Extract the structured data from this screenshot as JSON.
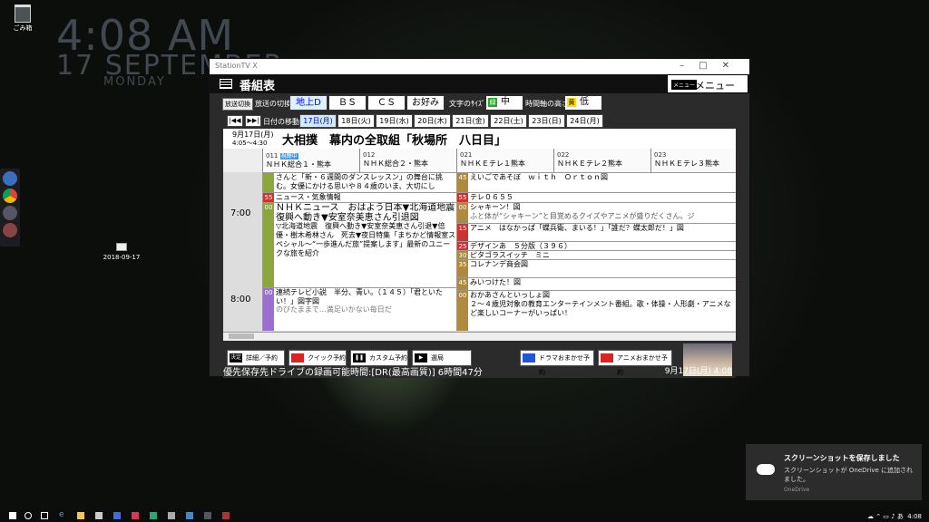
{
  "desktop": {
    "time": "4:08 AM",
    "date": "17 SEPTEMBER",
    "day": "MONDAY",
    "recycle_label": "ごみ箱",
    "shot_label": "2018-09-17"
  },
  "window": {
    "title": "StationTV X",
    "header": "番組表",
    "menu_key": "メニュー",
    "menu": "メニュー"
  },
  "toolbar": {
    "switch_key": "放送切換",
    "switch_label": "放送の切換",
    "tabs": [
      "地上D",
      "ＢＳ",
      "ＣＳ",
      "お好み"
    ],
    "text_size_label": "文字のｻｲｽﾞ",
    "text_size_key": "緑",
    "text_size": "中",
    "axis_label": "時間軸の高さ",
    "axis_key": "黄",
    "axis": "低"
  },
  "datebar": {
    "move_label": "日付の移動",
    "days": [
      "17日(月)",
      "18日(火)",
      "19日(水)",
      "20日(木)",
      "21日(金)",
      "22日(土)",
      "23日(日)",
      "24日(月)"
    ]
  },
  "program": {
    "date": "9月17日(月)",
    "time": "4:05～4:30",
    "title": "大相撲　幕内の全取組「秋場所　八日目」"
  },
  "channels": [
    {
      "num": "011",
      "live": "視聴中",
      "name": "ＮＨＫ総合１・熊本"
    },
    {
      "num": "012",
      "name": "ＮＨＫ総合２・熊本"
    },
    {
      "num": "021",
      "name": "ＮＨＫＥテレ１熊本"
    },
    {
      "num": "022",
      "name": "ＮＨＫＥテレ２熊本"
    },
    {
      "num": "023",
      "name": "ＮＨＫＥテレ３熊本"
    }
  ],
  "times": [
    "7:00",
    "8:00"
  ],
  "col1": [
    {
      "min": "",
      "text": "さんと「新・６週間のダンスレッスン」の舞台に挑む。女優にかける思いや８４歳のいま、大切にし"
    },
    {
      "min": "55",
      "text": "ニュース・気象情報"
    },
    {
      "min": "00",
      "text": "ＮＨＫニュース　おはよう日本▼北海道地震　復興へ動き▼安室奈美恵さん引退図"
    },
    {
      "min": "",
      "text": "▽北海道地震　復興へ動き▼安室奈美恵さん引退▼倍優・樹木希林さん　死去▼夜日特集「まちかど情報室スペシャル〜“一歩進んだ旅”提案します」最新のユニークな旅を紹介"
    },
    {
      "min": "00",
      "text": "連続テレビ小説　半分、青い。（１４５）「君といたい！」図字図"
    },
    {
      "min": "",
      "text": "のびたままで…満足いかない毎日だ"
    }
  ],
  "col3": [
    {
      "min": "45",
      "text": "えいごであそぼ　ｗｉｔｈ　Ｏｒｔｏｎ図"
    },
    {
      "min": "55",
      "text": "テレ０６５５"
    },
    {
      "min": "00",
      "text": "シャキーン！図"
    },
    {
      "min": "",
      "text": "ふと体が“シャキーン”と目覚めるクイズやアニメが盛りだくさん。ジ"
    },
    {
      "min": "15",
      "text": "アニメ　はなかっぱ「蝶兵衛、まいる！」「誰だ？蝶太郎だ！」図"
    },
    {
      "min": "25",
      "text": "デザインあ　５分版（３９６）"
    },
    {
      "min": "30",
      "text": "ピタゴラスイッチ　ミニ"
    },
    {
      "min": "35",
      "text": "コレナンデ商会図"
    },
    {
      "min": "45",
      "text": "みいつけた！図"
    },
    {
      "min": "00",
      "text": "おかあさんといっしょ図"
    },
    {
      "min": "",
      "text": "２〜４歳児対象の教育エンターテインメント番組。歌・体操・人形劇・アニメなど楽しいコーナーがいっぱい！"
    }
  ],
  "actions": [
    {
      "key": "決定",
      "label": "詳細／予約"
    },
    {
      "key": "■",
      "label": "クイック予約"
    },
    {
      "key": "❚❚",
      "label": "カスタム予約"
    },
    {
      "key": "▶",
      "label": "選局"
    },
    {
      "key": "■",
      "label": "ドラマおまかせ予約"
    },
    {
      "key": "■",
      "label": "アニメおまかせ予約"
    }
  ],
  "status": {
    "left": "優先保存先ドライブの録画可能時間:[DR(最高画質)] 6時間47分",
    "right": "9月17日(月) 4:08"
  },
  "toast": {
    "title": "スクリーンショットを保存しました",
    "body": "スクリーンショットが OneDrive に追加されました。",
    "app": "OneDrive"
  },
  "taskbar": {
    "clock": "4:08"
  },
  "colors": {
    "accent": "#3399ff",
    "col1_min": "#8aa63c",
    "col3_min": "#b08a3c",
    "min_red": "#cc3333"
  }
}
